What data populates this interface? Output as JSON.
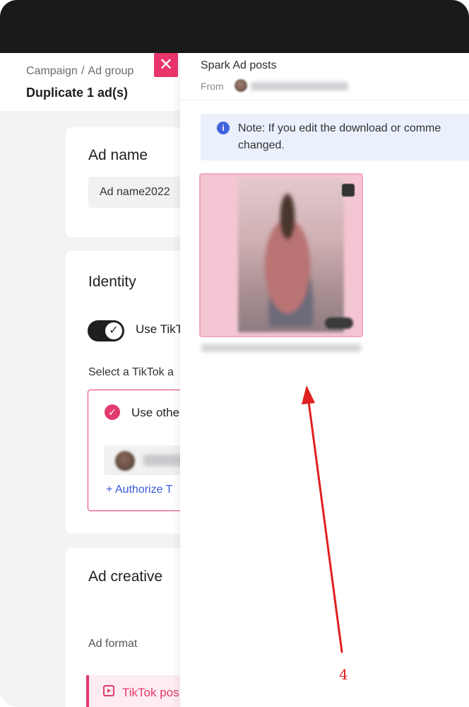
{
  "header": {
    "breadcrumb": [
      "Campaign",
      "Ad group"
    ],
    "breadcrumb_separator": "/",
    "title": "Duplicate 1 ad(s)"
  },
  "close_button": {
    "icon": "close-icon",
    "glyph": "✕"
  },
  "ad_name_card": {
    "title": "Ad name",
    "input_value": "Ad name2022"
  },
  "identity_card": {
    "title": "Identity",
    "toggle": {
      "label": "Use TikTok",
      "checked": true,
      "icon": "check-icon"
    },
    "select_label": "Select a TikTok a",
    "option": {
      "label": "Use othe",
      "selected": true
    },
    "authorize_link": "+ Authorize T"
  },
  "creative_card": {
    "title": "Ad creative",
    "format_label": "Ad format",
    "format_option": "TikTok pos"
  },
  "drawer": {
    "title": "Spark Ad posts",
    "from_label": "From",
    "note": "Note: If you edit the download or comme changed."
  },
  "annotation": {
    "label": "4",
    "color": "#e02020"
  },
  "colors": {
    "accent": "#e9356b",
    "link": "#3b5bdb",
    "info": "#3e63dd",
    "note_bg": "#eaf0fc"
  }
}
